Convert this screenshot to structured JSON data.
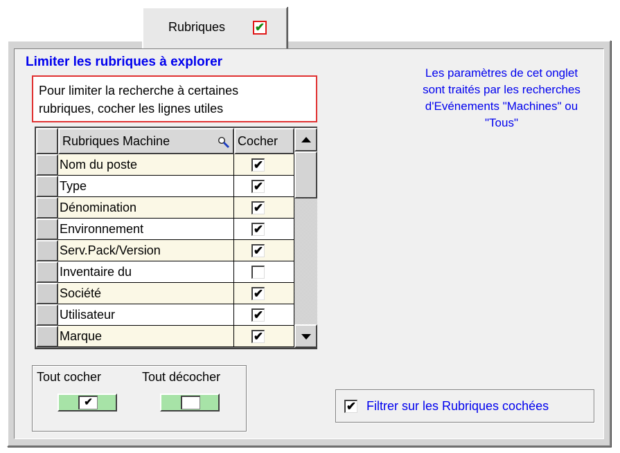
{
  "tab": {
    "label": "Rubriques",
    "checked_mark": "✔"
  },
  "section": {
    "title": "Limiter les rubriques à explorer",
    "hint_line1": "Pour limiter la recherche à certaines",
    "hint_line2": "rubriques, cocher les lignes utiles"
  },
  "info": {
    "line1": "Les paramètres de cet onglet",
    "line2": "sont traités par les recherches",
    "line3": "d'Evénements \"Machines\"  ou",
    "line4": "\"Tous\""
  },
  "table": {
    "columns": [
      "Rubriques Machine",
      "Cocher"
    ],
    "header_icon": "search-icon",
    "rows": [
      {
        "name": "Nom du poste",
        "checked": true
      },
      {
        "name": "Type",
        "checked": true
      },
      {
        "name": "Dénomination",
        "checked": true
      },
      {
        "name": "Environnement",
        "checked": true
      },
      {
        "name": "Serv.Pack/Version",
        "checked": true
      },
      {
        "name": "Inventaire du",
        "checked": false
      },
      {
        "name": "Société",
        "checked": true
      },
      {
        "name": "Utilisateur",
        "checked": true
      },
      {
        "name": "Marque",
        "checked": true
      }
    ]
  },
  "toggles": {
    "all_label": "Tout cocher",
    "none_label": "Tout décocher",
    "all_state": "checked",
    "none_state": "unchecked"
  },
  "filter": {
    "label": "Filtrer sur les Rubriques cochées",
    "checked": true
  },
  "colors": {
    "accent_text": "#0000ee",
    "row_alt": "#fbf8e6",
    "switch_fill": "#a7e3a7",
    "hint_border": "#e03030"
  }
}
